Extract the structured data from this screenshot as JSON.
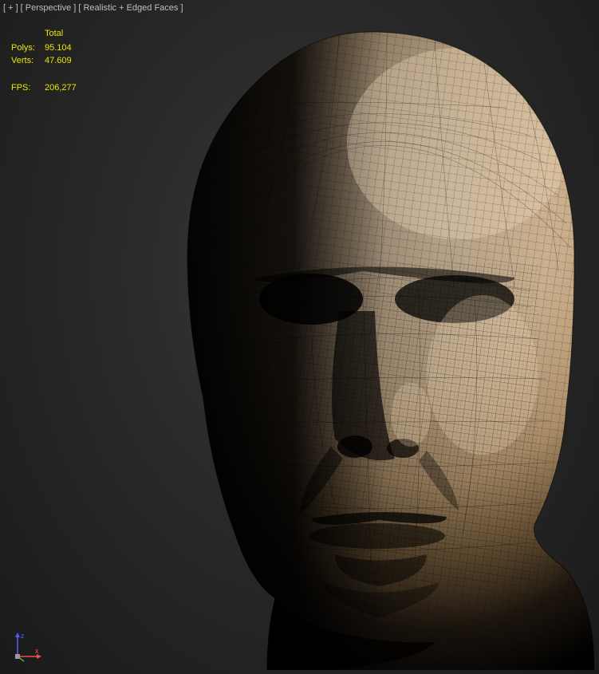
{
  "viewport": {
    "plus_label": "[ + ]",
    "view_label": "[ Perspective ]",
    "shading_label": "[ Realistic + Edged Faces ]"
  },
  "stats": {
    "total_header": "Total",
    "polys_label": "Polys:",
    "polys_value": "95.104",
    "verts_label": "Verts:",
    "verts_value": "47.609",
    "fps_label": "FPS:",
    "fps_value": "206,277"
  },
  "axis": {
    "x": "x",
    "z": "z"
  }
}
